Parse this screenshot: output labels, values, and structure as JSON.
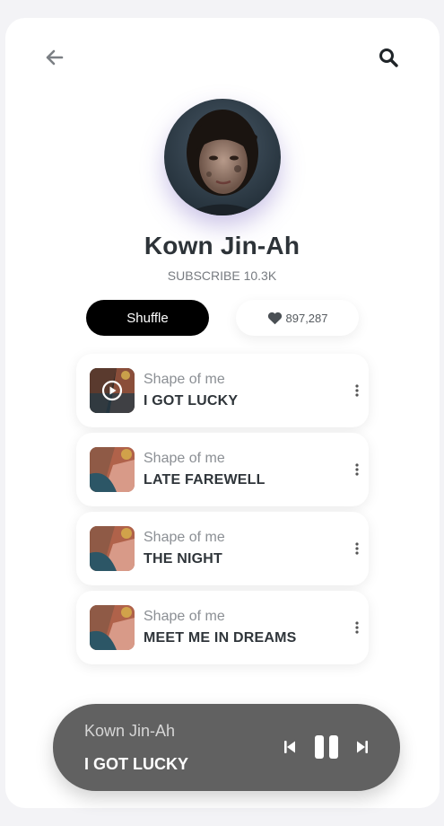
{
  "header": {
    "back_icon": "arrow-left-icon",
    "search_icon": "search-icon"
  },
  "artist": {
    "name": "Kown Jin-Ah",
    "subscribe": "SUBSCRIBE 10.3K"
  },
  "actions": {
    "shuffle_label": "Shuffle",
    "likes_count": "897,287",
    "likes_icon": "heart-icon"
  },
  "tracks": [
    {
      "subtitle": "Shape of me",
      "title": "I GOT LUCKY",
      "playing": true
    },
    {
      "subtitle": "Shape of me",
      "title": "LATE FAREWELL"
    },
    {
      "subtitle": "Shape of me",
      "title": "THE NIGHT"
    },
    {
      "subtitle": "Shape of me",
      "title": "MEET ME IN DREAMS"
    }
  ],
  "player": {
    "artist": "Kown Jin-Ah",
    "title": "I GOT LUCKY",
    "state": "playing"
  },
  "colors": {
    "accent": "#000000",
    "player_bg": "#616161",
    "text_dark": "#2d3338"
  }
}
